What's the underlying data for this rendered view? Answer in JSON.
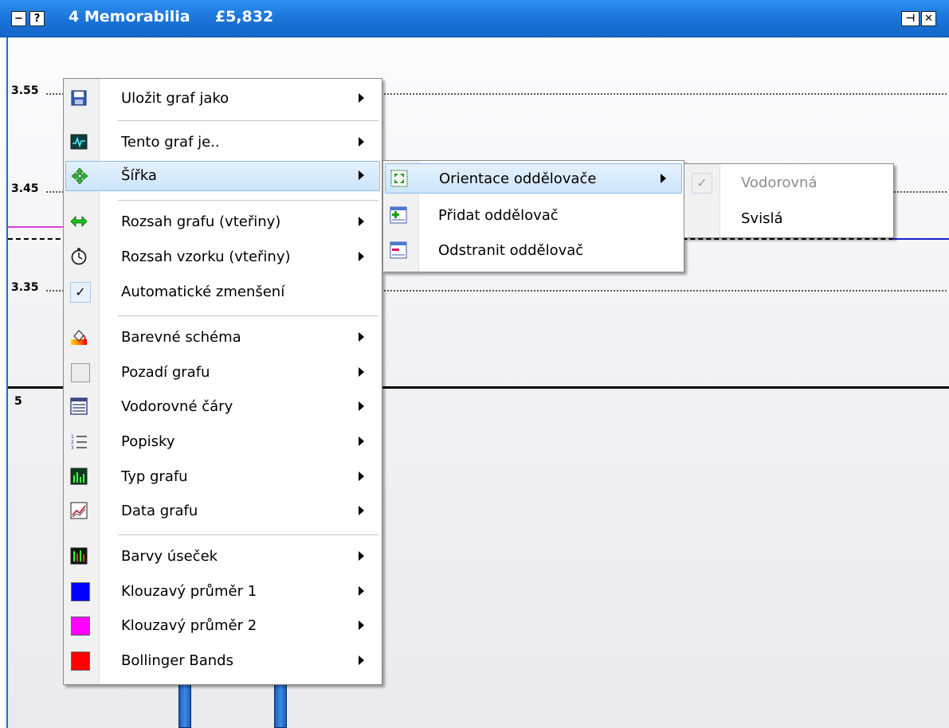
{
  "window": {
    "title": "4 Memorabilia",
    "value": "£5,832",
    "buttons": {
      "minimize": "−",
      "help": "?",
      "pin": "⊣",
      "close": "✕"
    }
  },
  "chart": {
    "y_labels": [
      "3.55",
      "3.45",
      "3.35"
    ],
    "lower_panel_label": "5"
  },
  "context_menu": {
    "items": [
      {
        "label": "Uložit graf jako",
        "icon": "save-icon",
        "has_submenu": true
      },
      {
        "label": "Tento graf je..",
        "icon": "chart-monitor-icon",
        "has_submenu": true
      },
      {
        "label": "Šířka",
        "icon": "move-arrows-icon",
        "has_submenu": true,
        "highlighted": true
      },
      {
        "label": "Rozsah grafu (vteřiny)",
        "icon": "horizontal-arrows-icon",
        "has_submenu": true
      },
      {
        "label": "Rozsah vzorku (vteřiny)",
        "icon": "stopwatch-icon",
        "has_submenu": true
      },
      {
        "label": "Automatické zmenšení",
        "icon": "checkmark-icon",
        "checked": true
      },
      {
        "label": "Barevné schéma",
        "icon": "paint-bucket-icon",
        "has_submenu": true
      },
      {
        "label": "Pozadí grafu",
        "icon": "background-swatch-icon",
        "has_submenu": true
      },
      {
        "label": "Vodorovné čáry",
        "icon": "horizontal-lines-icon",
        "has_submenu": true
      },
      {
        "label": "Popisky",
        "icon": "numbered-list-icon",
        "has_submenu": true
      },
      {
        "label": "Typ grafu",
        "icon": "chart-type-icon",
        "has_submenu": true
      },
      {
        "label": "Data grafu",
        "icon": "line-chart-icon",
        "has_submenu": true
      },
      {
        "label": "Barvy úseček",
        "icon": "bar-colors-icon",
        "has_submenu": true
      },
      {
        "label": "Klouzavý průměr 1",
        "icon": "blue-swatch",
        "color": "#0000ff",
        "has_submenu": true
      },
      {
        "label": "Klouzavý průměr 2",
        "icon": "magenta-swatch",
        "color": "#ff00ff",
        "has_submenu": true
      },
      {
        "label": "Bollinger Bands",
        "icon": "red-swatch",
        "color": "#ff0000",
        "has_submenu": true
      }
    ]
  },
  "submenu_sirka": {
    "items": [
      {
        "label": "Orientace oddělovače",
        "icon": "separator-orientation-icon",
        "has_submenu": true,
        "highlighted": true
      },
      {
        "label": "Přidat oddělovač",
        "icon": "add-separator-icon"
      },
      {
        "label": "Odstranit oddělovač",
        "icon": "remove-separator-icon"
      }
    ]
  },
  "submenu_orientation": {
    "items": [
      {
        "label": "Vodorovná",
        "checked": true,
        "disabled": true
      },
      {
        "label": "Svislá"
      }
    ]
  },
  "colors": {
    "titlebar": "#1a73d8",
    "highlight": "#cde5fb",
    "ma1": "#0000ff",
    "ma2": "#ff00ff",
    "bollinger": "#ff0000"
  }
}
